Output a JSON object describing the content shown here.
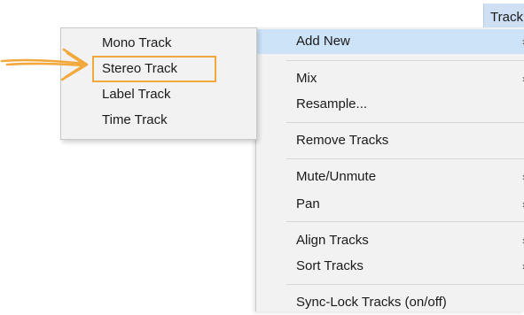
{
  "menubar": {
    "track_label": "Track"
  },
  "tracks_menu": {
    "items": [
      {
        "label": "Add New",
        "has_submenu": true
      },
      {
        "label": "Mix",
        "has_submenu": true
      },
      {
        "label": "Resample..."
      },
      {
        "label": "Remove Tracks"
      },
      {
        "label": "Mute/Unmute",
        "has_submenu": true
      },
      {
        "label": "Pan",
        "has_submenu": true
      },
      {
        "label": "Align Tracks",
        "has_submenu": true
      },
      {
        "label": "Sort Tracks",
        "has_submenu": true
      },
      {
        "label": "Sync-Lock Tracks (on/off)"
      }
    ],
    "submenu_arrow": "›"
  },
  "add_new_submenu": {
    "items": [
      {
        "label": "Mono Track"
      },
      {
        "label": "Stereo Track"
      },
      {
        "label": "Label Track"
      },
      {
        "label": "Time Track"
      }
    ]
  },
  "annotation": {
    "pointer_icon": "arrow-right-icon",
    "pointer_color": "#f2a83b",
    "highlight_color": "#f2a83b"
  }
}
